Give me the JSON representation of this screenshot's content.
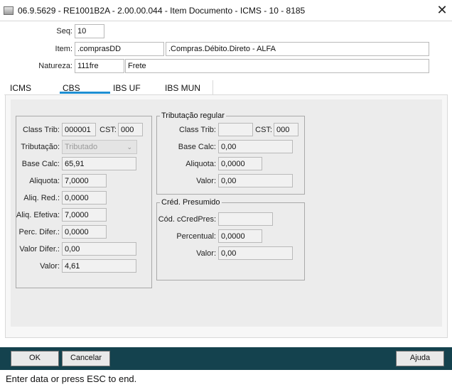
{
  "window": {
    "title": "06.9.5629 - RE1001B2A - 2.00.00.044 - Item Documento - ICMS - 10 - 8185",
    "close_glyph": "✕"
  },
  "header": {
    "seq_label": "Seq:",
    "seq_value": "10",
    "item_label": "Item:",
    "item_code": ".comprasDD",
    "item_desc": ".Compras.Débito.Direto - ALFA",
    "natureza_label": "Natureza:",
    "natureza_code": "111fre",
    "natureza_desc": "Frete"
  },
  "tabs": [
    {
      "label": "ICMS",
      "active": false
    },
    {
      "label": "CBS",
      "active": true
    },
    {
      "label": "IBS UF",
      "active": false
    },
    {
      "label": "IBS MUN",
      "active": false
    }
  ],
  "left_group": {
    "class_trib_label": "Class Trib:",
    "class_trib_value": "000001",
    "cst_label": "CST:",
    "cst_value": "000",
    "tributacao_label": "Tributação:",
    "tributacao_value": "Tributado",
    "base_calc_label": "Base Calc:",
    "base_calc_value": "65,91",
    "aliquota_label": "Aliquota:",
    "aliquota_value": "7,0000",
    "aliq_red_label": "Aliq. Red.:",
    "aliq_red_value": "0,0000",
    "aliq_efetiva_label": "Aliq. Efetiva:",
    "aliq_efetiva_value": "7,0000",
    "perc_difer_label": "Perc. Difer.:",
    "perc_difer_value": "0,0000",
    "valor_difer_label": "Valor Difer.:",
    "valor_difer_value": "0,00",
    "valor_label": "Valor:",
    "valor_value": "4,61"
  },
  "tributacao_regular": {
    "title": "Tributação regular",
    "class_trib_label": "Class Trib:",
    "class_trib_value": "",
    "cst_label": "CST:",
    "cst_value": "000",
    "base_calc_label": "Base Calc:",
    "base_calc_value": "0,00",
    "aliquota_label": "Aliquota:",
    "aliquota_value": "0,0000",
    "valor_label": "Valor:",
    "valor_value": "0,00"
  },
  "cred_presumido": {
    "title": "Créd. Presumido",
    "cod_label": "Cód. cCredPres:",
    "cod_value": "",
    "percentual_label": "Percentual:",
    "percentual_value": "0,0000",
    "valor_label": "Valor:",
    "valor_value": "0,00"
  },
  "buttons": {
    "ok": "OK",
    "cancelar": "Cancelar",
    "ajuda": "Ajuda"
  },
  "status": {
    "text": "Enter data or press ESC to end."
  },
  "colors": {
    "accent": "#1d8fd3",
    "bottom_bar": "#14424e"
  }
}
